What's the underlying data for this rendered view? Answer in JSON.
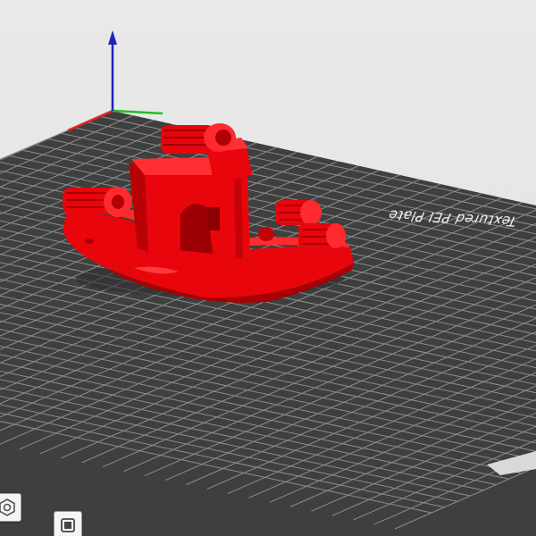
{
  "viewport": {
    "bed_label": "Textured PEI Plate"
  },
  "model": {
    "color": "#e8050b"
  },
  "colors": {
    "bed_surface": "#3e3f3e",
    "grid_line": "#8c8e8c",
    "axis_x": "#e32626",
    "axis_y": "#1fc021",
    "axis_z": "#1f24b8"
  },
  "toolbar": {
    "icons": [
      "layflat-icon",
      "support-paint-icon"
    ]
  }
}
